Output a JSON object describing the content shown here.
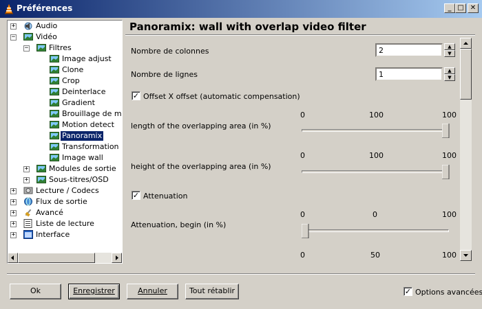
{
  "window": {
    "title": "Préférences"
  },
  "tree": [
    {
      "label": "Audio",
      "level": 0,
      "expander": "+",
      "icon": "audio-icon"
    },
    {
      "label": "Vidéo",
      "level": 0,
      "expander": "-",
      "icon": "video-icon"
    },
    {
      "label": "Filtres",
      "level": 1,
      "expander": "-",
      "icon": "video-icon"
    },
    {
      "label": "Image adjust",
      "level": 2,
      "icon": "video-icon"
    },
    {
      "label": "Clone",
      "level": 2,
      "icon": "video-icon"
    },
    {
      "label": "Crop",
      "level": 2,
      "icon": "video-icon"
    },
    {
      "label": "Deinterlace",
      "level": 2,
      "icon": "video-icon"
    },
    {
      "label": "Gradient",
      "level": 2,
      "icon": "video-icon"
    },
    {
      "label": "Brouillage de mouv",
      "level": 2,
      "icon": "video-icon"
    },
    {
      "label": "Motion detect",
      "level": 2,
      "icon": "video-icon"
    },
    {
      "label": "Panoramix",
      "level": 2,
      "icon": "video-icon",
      "selected": true
    },
    {
      "label": "Transformation",
      "level": 2,
      "icon": "video-icon"
    },
    {
      "label": "Image wall",
      "level": 2,
      "icon": "video-icon"
    },
    {
      "label": "Modules de sortie",
      "level": 1,
      "expander": "+",
      "icon": "video-icon"
    },
    {
      "label": "Sous-titres/OSD",
      "level": 1,
      "expander": "+",
      "icon": "video-icon"
    },
    {
      "label": "Lecture / Codecs",
      "level": 0,
      "expander": "+",
      "icon": "codecs-icon"
    },
    {
      "label": "Flux de sortie",
      "level": 0,
      "expander": "+",
      "icon": "stream-icon"
    },
    {
      "label": "Avancé",
      "level": 0,
      "expander": "+",
      "icon": "advanced-icon"
    },
    {
      "label": "Liste de lecture",
      "level": 0,
      "expander": "+",
      "icon": "playlist-icon"
    },
    {
      "label": "Interface",
      "level": 0,
      "expander": "+",
      "icon": "interface-icon"
    }
  ],
  "panel": {
    "title": "Panoramix: wall with overlap video filter",
    "columns": {
      "label": "Nombre de colonnes",
      "value": "2"
    },
    "rows": {
      "label": "Nombre de lignes",
      "value": "1"
    },
    "offset": {
      "label": "Offset X offset (automatic compensation)",
      "checked": true
    },
    "length_overlap": {
      "label": "length of the overlapping area (in %)",
      "min": "0",
      "mid": "100",
      "max": "100",
      "value": 100
    },
    "height_overlap": {
      "label": "height of the overlapping area (in %)",
      "min": "0",
      "mid": "100",
      "max": "100",
      "value": 100
    },
    "attenuation": {
      "label": "Attenuation",
      "checked": true
    },
    "att_begin": {
      "label": "Attenuation, begin (in %)",
      "min": "0",
      "mid": "0",
      "max": "100",
      "value": 0
    },
    "next_slider": {
      "min": "0",
      "mid": "50",
      "max": "100"
    }
  },
  "buttons": {
    "ok": "Ok",
    "save": "Enregistrer",
    "cancel": "Annuler",
    "reset": "Tout rétablir"
  },
  "advanced_options": {
    "label": "Options avancées",
    "checked": true
  }
}
